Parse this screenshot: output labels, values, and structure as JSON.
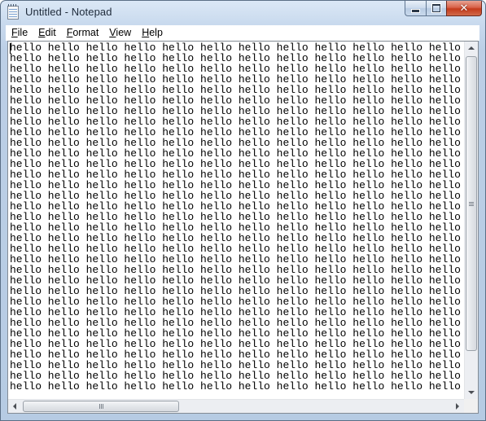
{
  "window": {
    "title": "Untitled - Notepad",
    "app_icon": "notepad-icon",
    "caption_buttons": {
      "minimize": "minimize-icon",
      "maximize": "maximize-icon",
      "close": "close-icon",
      "close_glyph": "✕"
    }
  },
  "menubar": {
    "items": [
      {
        "mnemonic": "F",
        "rest": "ile"
      },
      {
        "mnemonic": "E",
        "rest": "dit"
      },
      {
        "mnemonic": "F",
        "rest": "ormat"
      },
      {
        "mnemonic": "V",
        "rest": "iew"
      },
      {
        "mnemonic": "H",
        "rest": "elp"
      }
    ]
  },
  "editor": {
    "word": "hello",
    "words_per_line": 12,
    "visible_lines": 33,
    "text": "hello hello hello hello hello hello hello hello hello hello hello hello\nhello hello hello hello hello hello hello hello hello hello hello hello\nhello hello hello hello hello hello hello hello hello hello hello hello\nhello hello hello hello hello hello hello hello hello hello hello hello\nhello hello hello hello hello hello hello hello hello hello hello hello\nhello hello hello hello hello hello hello hello hello hello hello hello\nhello hello hello hello hello hello hello hello hello hello hello hello\nhello hello hello hello hello hello hello hello hello hello hello hello\nhello hello hello hello hello hello hello hello hello hello hello hello\nhello hello hello hello hello hello hello hello hello hello hello hello\nhello hello hello hello hello hello hello hello hello hello hello hello\nhello hello hello hello hello hello hello hello hello hello hello hello\nhello hello hello hello hello hello hello hello hello hello hello hello\nhello hello hello hello hello hello hello hello hello hello hello hello\nhello hello hello hello hello hello hello hello hello hello hello hello\nhello hello hello hello hello hello hello hello hello hello hello hello\nhello hello hello hello hello hello hello hello hello hello hello hello\nhello hello hello hello hello hello hello hello hello hello hello hello\nhello hello hello hello hello hello hello hello hello hello hello hello\nhello hello hello hello hello hello hello hello hello hello hello hello\nhello hello hello hello hello hello hello hello hello hello hello hello\nhello hello hello hello hello hello hello hello hello hello hello hello\nhello hello hello hello hello hello hello hello hello hello hello hello\nhello hello hello hello hello hello hello hello hello hello hello hello\nhello hello hello hello hello hello hello hello hello hello hello hello\nhello hello hello hello hello hello hello hello hello hello hello hello\nhello hello hello hello hello hello hello hello hello hello hello hello\nhello hello hello hello hello hello hello hello hello hello hello hello\nhello hello hello hello hello hello hello hello hello hello hello hello\nhello hello hello hello hello hello hello hello hello hello hello hello\nhello hello hello hello hello hello hello hello hello hello hello hello\nhello hello hello hello hello hello hello hello hello hello hello hello\nhello hello hello hello hello hello hello hello hello hello hello hello"
  },
  "scrollbars": {
    "vertical": {
      "up_icon": "arrow-up-icon",
      "down_icon": "arrow-down-icon",
      "grip_icon": "grip-icon"
    },
    "horizontal": {
      "left_icon": "arrow-left-icon",
      "right_icon": "arrow-right-icon",
      "grip_icon": "grip-icon"
    }
  },
  "colors": {
    "frame": "#bccfe6",
    "close_button": "#c43a1b",
    "text": "#000000",
    "editor_background": "#ffffff"
  }
}
